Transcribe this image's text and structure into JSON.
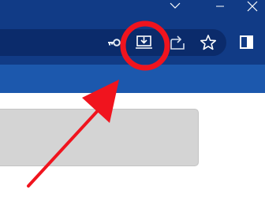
{
  "window": {
    "controls": [
      "chevron-down-icon",
      "close-icon"
    ]
  },
  "toolbar": {
    "icons": [
      "key-icon",
      "install-app-icon",
      "share-icon",
      "star-icon",
      "sidebar-icon"
    ]
  },
  "colors": {
    "titlebar": "#113b86",
    "toolbar": "#113b86",
    "omnibox": "#0b2b6b",
    "bookmarks_bar": "#1c58ad",
    "annotation": "#f0141e",
    "content_box": "#d4d4d4"
  },
  "annotation": {
    "circle_target": "install-app-icon",
    "arrow_target": "install-app-icon"
  }
}
